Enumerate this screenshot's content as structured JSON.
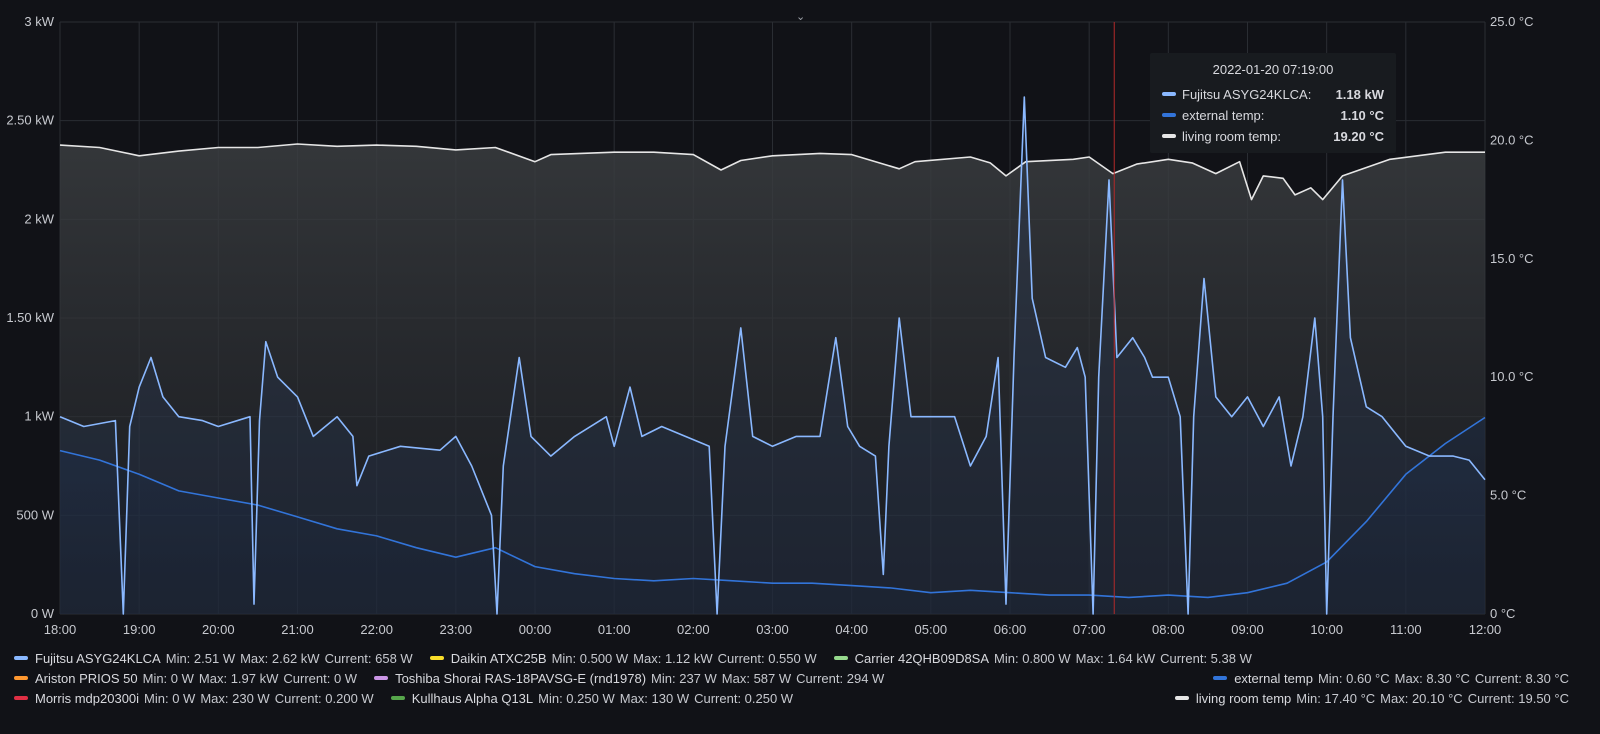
{
  "chart_data": {
    "type": "line",
    "x_range": [
      "18:00",
      "12:00"
    ],
    "x_ticks": [
      "18:00",
      "19:00",
      "20:00",
      "21:00",
      "22:00",
      "23:00",
      "00:00",
      "01:00",
      "02:00",
      "03:00",
      "04:00",
      "05:00",
      "06:00",
      "07:00",
      "08:00",
      "09:00",
      "10:00",
      "11:00",
      "12:00"
    ],
    "y_left": {
      "min": 0,
      "max": 3,
      "unit": "kW",
      "ticks": [
        "0 W",
        "500 W",
        "1 kW",
        "1.50 kW",
        "2 kW",
        "2.50 kW",
        "3 kW"
      ]
    },
    "y_right": {
      "min": 0,
      "max": 25,
      "unit": "°C",
      "ticks": [
        "0 °C",
        "5.0 °C",
        "10.0 °C",
        "15.0 °C",
        "20.0 °C",
        "25.0 °C"
      ]
    },
    "grid": true,
    "crosshair_time": "07:19",
    "series": [
      {
        "name": "living room temp",
        "axis": "right",
        "color": "#e6e6e6",
        "points": [
          [
            0,
            19.8
          ],
          [
            0.5,
            19.7
          ],
          [
            1.0,
            19.35
          ],
          [
            1.5,
            19.55
          ],
          [
            2.0,
            19.7
          ],
          [
            2.5,
            19.7
          ],
          [
            3.0,
            19.85
          ],
          [
            3.5,
            19.75
          ],
          [
            4.0,
            19.8
          ],
          [
            4.5,
            19.75
          ],
          [
            5.0,
            19.6
          ],
          [
            5.5,
            19.7
          ],
          [
            6.0,
            19.1
          ],
          [
            6.2,
            19.4
          ],
          [
            7.0,
            19.5
          ],
          [
            7.5,
            19.5
          ],
          [
            8.0,
            19.4
          ],
          [
            8.35,
            18.75
          ],
          [
            8.6,
            19.15
          ],
          [
            9.0,
            19.35
          ],
          [
            9.6,
            19.45
          ],
          [
            10.0,
            19.4
          ],
          [
            10.6,
            18.8
          ],
          [
            10.8,
            19.1
          ],
          [
            11.5,
            19.3
          ],
          [
            11.75,
            19.05
          ],
          [
            11.95,
            18.5
          ],
          [
            12.2,
            19.1
          ],
          [
            12.8,
            19.2
          ],
          [
            13.0,
            19.3
          ],
          [
            13.3,
            18.6
          ],
          [
            13.6,
            19.0
          ],
          [
            14.0,
            19.2
          ],
          [
            14.3,
            19.05
          ],
          [
            14.6,
            18.6
          ],
          [
            14.9,
            19.1
          ],
          [
            15.05,
            17.5
          ],
          [
            15.2,
            18.5
          ],
          [
            15.45,
            18.4
          ],
          [
            15.6,
            17.7
          ],
          [
            15.8,
            18.0
          ],
          [
            15.95,
            17.5
          ],
          [
            16.2,
            18.5
          ],
          [
            16.8,
            19.2
          ],
          [
            17.5,
            19.5
          ],
          [
            18.0,
            19.5
          ]
        ]
      },
      {
        "name": "external temp",
        "axis": "right",
        "color": "#3274d9",
        "points": [
          [
            0,
            6.9
          ],
          [
            0.5,
            6.5
          ],
          [
            1.0,
            5.9
          ],
          [
            1.5,
            5.2
          ],
          [
            2.0,
            4.9
          ],
          [
            2.5,
            4.6
          ],
          [
            3.0,
            4.1
          ],
          [
            3.5,
            3.6
          ],
          [
            4.0,
            3.3
          ],
          [
            4.5,
            2.8
          ],
          [
            5.0,
            2.4
          ],
          [
            5.5,
            2.8
          ],
          [
            6.0,
            2.0
          ],
          [
            6.5,
            1.7
          ],
          [
            7.0,
            1.5
          ],
          [
            7.5,
            1.4
          ],
          [
            8.0,
            1.5
          ],
          [
            8.5,
            1.4
          ],
          [
            9.0,
            1.3
          ],
          [
            9.5,
            1.3
          ],
          [
            10.0,
            1.2
          ],
          [
            10.5,
            1.1
          ],
          [
            11.0,
            0.9
          ],
          [
            11.5,
            1.0
          ],
          [
            12.0,
            0.9
          ],
          [
            12.5,
            0.8
          ],
          [
            13.0,
            0.8
          ],
          [
            13.5,
            0.7
          ],
          [
            14.0,
            0.8
          ],
          [
            14.5,
            0.7
          ],
          [
            15.0,
            0.9
          ],
          [
            15.5,
            1.3
          ],
          [
            16.0,
            2.2
          ],
          [
            16.5,
            3.9
          ],
          [
            17.0,
            5.9
          ],
          [
            17.5,
            7.2
          ],
          [
            18.0,
            8.3
          ]
        ]
      },
      {
        "name": "Fujitsu ASYG24KLCA",
        "axis": "left",
        "color": "#8ab8ff",
        "points": [
          [
            0,
            1.0
          ],
          [
            0.3,
            0.95
          ],
          [
            0.7,
            0.98
          ],
          [
            0.8,
            0.0
          ],
          [
            0.88,
            0.95
          ],
          [
            1.0,
            1.15
          ],
          [
            1.15,
            1.3
          ],
          [
            1.3,
            1.1
          ],
          [
            1.5,
            1.0
          ],
          [
            1.8,
            0.98
          ],
          [
            2.0,
            0.95
          ],
          [
            2.4,
            1.0
          ],
          [
            2.45,
            0.05
          ],
          [
            2.52,
            0.98
          ],
          [
            2.6,
            1.38
          ],
          [
            2.75,
            1.2
          ],
          [
            3.0,
            1.1
          ],
          [
            3.2,
            0.9
          ],
          [
            3.5,
            1.0
          ],
          [
            3.7,
            0.9
          ],
          [
            3.75,
            0.65
          ],
          [
            3.9,
            0.8
          ],
          [
            4.3,
            0.85
          ],
          [
            4.8,
            0.83
          ],
          [
            5.0,
            0.9
          ],
          [
            5.2,
            0.75
          ],
          [
            5.45,
            0.5
          ],
          [
            5.52,
            0.0
          ],
          [
            5.6,
            0.75
          ],
          [
            5.8,
            1.3
          ],
          [
            5.95,
            0.9
          ],
          [
            6.2,
            0.8
          ],
          [
            6.5,
            0.9
          ],
          [
            6.9,
            1.0
          ],
          [
            7.0,
            0.85
          ],
          [
            7.2,
            1.15
          ],
          [
            7.35,
            0.9
          ],
          [
            7.6,
            0.95
          ],
          [
            7.9,
            0.9
          ],
          [
            8.2,
            0.85
          ],
          [
            8.3,
            0.0
          ],
          [
            8.4,
            0.85
          ],
          [
            8.6,
            1.45
          ],
          [
            8.75,
            0.9
          ],
          [
            9.0,
            0.85
          ],
          [
            9.3,
            0.9
          ],
          [
            9.6,
            0.9
          ],
          [
            9.8,
            1.4
          ],
          [
            9.95,
            0.95
          ],
          [
            10.1,
            0.85
          ],
          [
            10.3,
            0.8
          ],
          [
            10.4,
            0.2
          ],
          [
            10.47,
            0.85
          ],
          [
            10.6,
            1.5
          ],
          [
            10.75,
            1.0
          ],
          [
            11.0,
            1.0
          ],
          [
            11.3,
            1.0
          ],
          [
            11.5,
            0.75
          ],
          [
            11.7,
            0.9
          ],
          [
            11.85,
            1.3
          ],
          [
            11.95,
            0.05
          ],
          [
            12.05,
            1.3
          ],
          [
            12.18,
            2.62
          ],
          [
            12.28,
            1.6
          ],
          [
            12.45,
            1.3
          ],
          [
            12.7,
            1.25
          ],
          [
            12.85,
            1.35
          ],
          [
            12.95,
            1.2
          ],
          [
            13.05,
            0.0
          ],
          [
            13.12,
            1.2
          ],
          [
            13.25,
            2.2
          ],
          [
            13.35,
            1.3
          ],
          [
            13.55,
            1.4
          ],
          [
            13.7,
            1.3
          ],
          [
            13.8,
            1.2
          ],
          [
            14.0,
            1.2
          ],
          [
            14.15,
            1.0
          ],
          [
            14.25,
            0.0
          ],
          [
            14.32,
            1.0
          ],
          [
            14.45,
            1.7
          ],
          [
            14.6,
            1.1
          ],
          [
            14.8,
            1.0
          ],
          [
            15.0,
            1.1
          ],
          [
            15.2,
            0.95
          ],
          [
            15.4,
            1.1
          ],
          [
            15.55,
            0.75
          ],
          [
            15.7,
            1.0
          ],
          [
            15.85,
            1.5
          ],
          [
            15.95,
            1.0
          ],
          [
            16.0,
            0.0
          ],
          [
            16.08,
            1.0
          ],
          [
            16.2,
            2.2
          ],
          [
            16.3,
            1.4
          ],
          [
            16.5,
            1.05
          ],
          [
            16.7,
            1.0
          ],
          [
            17.0,
            0.85
          ],
          [
            17.3,
            0.8
          ],
          [
            17.6,
            0.8
          ],
          [
            17.8,
            0.78
          ],
          [
            18.0,
            0.68
          ]
        ]
      }
    ]
  },
  "legend": {
    "rows": [
      [
        {
          "name": "Fujitsu ASYG24KLCA",
          "color": "#8ab8ff",
          "min": "Min: 2.51 W",
          "max": "Max: 2.62 kW",
          "current": "Current: 658 W"
        },
        {
          "name": "Daikin ATXC25B",
          "color": "#fade2a",
          "min": "Min: 0.500 W",
          "max": "Max: 1.12 kW",
          "current": "Current: 0.550 W"
        },
        {
          "name": "Carrier 42QHB09D8SA",
          "color": "#96d98d",
          "min": "Min: 0.800 W",
          "max": "Max: 1.64 kW",
          "current": "Current: 5.38 W"
        }
      ],
      [
        {
          "name": "Ariston PRIOS 50",
          "color": "#ff9830",
          "min": "Min: 0 W",
          "max": "Max: 1.97 kW",
          "current": "Current: 0 W"
        },
        {
          "name": "Toshiba Shorai RAS-18PAVSG-E (rnd1978)",
          "color": "#ca95e5",
          "min": "Min: 237 W",
          "max": "Max: 587 W",
          "current": "Current: 294 W"
        }
      ],
      [
        {
          "name": "Morris mdp20300i",
          "color": "#e02f44",
          "min": "Min: 0 W",
          "max": "Max: 230 W",
          "current": "Current: 0.200 W"
        },
        {
          "name": "Kullhaus Alpha Q13L",
          "color": "#56a64b",
          "min": "Min: 0.250 W",
          "max": "Max: 130 W",
          "current": "Current: 0.250 W"
        }
      ]
    ],
    "right": [
      {
        "name": "external temp",
        "color": "#3274d9",
        "min": "Min: 0.60 °C",
        "max": "Max: 8.30 °C",
        "current": "Current: 8.30 °C"
      },
      {
        "name": "living room temp",
        "color": "#e6e6e6",
        "min": "Min: 17.40 °C",
        "max": "Max: 20.10 °C",
        "current": "Current: 19.50 °C"
      }
    ]
  },
  "tooltip": {
    "title": "2022-01-20 07:19:00",
    "rows": [
      {
        "name": "Fujitsu ASYG24KLCA:",
        "value": "1.18 kW",
        "color": "#8ab8ff"
      },
      {
        "name": "external temp:",
        "value": "1.10 °C",
        "color": "#3274d9"
      },
      {
        "name": "living room temp:",
        "value": "19.20 °C",
        "color": "#e6e6e6"
      }
    ]
  },
  "collapse_icon": "chevron-down-icon",
  "collapse_glyph": "⌄"
}
